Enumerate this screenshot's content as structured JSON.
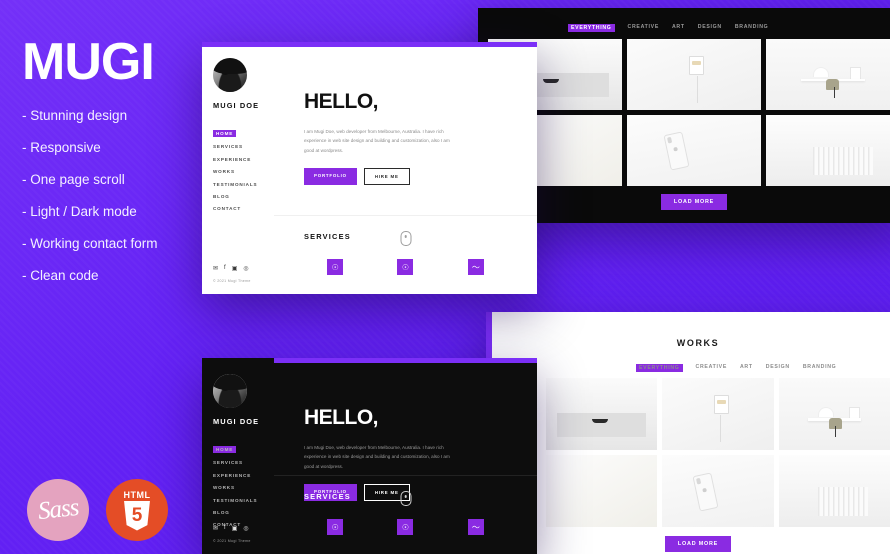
{
  "promo": {
    "title": "MUGI",
    "features": [
      "- Stunning design",
      "- Responsive",
      "- One page scroll",
      "- Light / Dark mode",
      "- Working contact form",
      "- Clean code"
    ]
  },
  "badges": [
    {
      "name": "Sass",
      "label": "Sass",
      "color": "#e4a3bf"
    },
    {
      "name": "HTML5",
      "top": "HTML",
      "num": "5",
      "color": "#e44d26"
    }
  ],
  "colors": {
    "background_purple": "#6622f5",
    "accent_purple": "#8a2be2",
    "topbar_purple": "#7b2ff7",
    "dark_panel": "#0d0d0d",
    "light_panel": "#ffffff"
  },
  "sidebar": {
    "name": "MUGI DOE",
    "nav": [
      {
        "label": "HOME",
        "active": true
      },
      {
        "label": "SERVICES",
        "active": false
      },
      {
        "label": "EXPERIENCE",
        "active": false
      },
      {
        "label": "WORKS",
        "active": false
      },
      {
        "label": "TESTIMONIALS",
        "active": false
      },
      {
        "label": "BLOG",
        "active": false
      },
      {
        "label": "CONTACT",
        "active": false
      }
    ],
    "socials": [
      "twitter-icon",
      "facebook-icon",
      "instagram-icon",
      "dribbble-icon"
    ],
    "copyright": "© 2021 Mugi Theme"
  },
  "hero": {
    "heading": "HELLO,",
    "body": "I am Mugi Doe, web developer from Melbourne, Australia. I have rich experience in web site design and building and customization, also I am good at wordpress.",
    "primary_button": "PORTFOLIO",
    "ghost_button": "HIRE ME",
    "scroll_icon": "mouse-scroll-icon"
  },
  "services": {
    "heading": "SERVICES",
    "items": [
      {
        "icon": "lightbulb-icon",
        "glyph": "☉"
      },
      {
        "icon": "lightbulb-icon",
        "glyph": "☉"
      },
      {
        "icon": "chart-line-icon",
        "glyph": "〜"
      }
    ]
  },
  "portfolio": {
    "heading": "WORKS",
    "filters": [
      {
        "label": "EVERYTHING",
        "active": true
      },
      {
        "label": "CREATIVE",
        "active": false
      },
      {
        "label": "ART",
        "active": false
      },
      {
        "label": "DESIGN",
        "active": false
      },
      {
        "label": "BRANDING",
        "active": false
      }
    ],
    "load_more": "LOAD MORE",
    "thumbnails_dark": [
      {
        "name": "thumb-drawer",
        "art": "art-drawer"
      },
      {
        "name": "thumb-charger",
        "art": "art-charger"
      },
      {
        "name": "thumb-desk",
        "art": "art-desk"
      },
      {
        "name": "thumb-plain",
        "art": "art-plain"
      },
      {
        "name": "thumb-phone",
        "art": "art-phone"
      },
      {
        "name": "thumb-radiator",
        "art": "art-rad"
      }
    ],
    "thumbnails_light": [
      {
        "name": "thumb-drawer",
        "art": "art-drawer"
      },
      {
        "name": "thumb-charger",
        "art": "art-charger"
      },
      {
        "name": "thumb-desk",
        "art": "art-desk"
      },
      {
        "name": "thumb-plain",
        "art": "art-plain"
      },
      {
        "name": "thumb-phone",
        "art": "art-phone"
      },
      {
        "name": "thumb-radiator",
        "art": "art-rad"
      }
    ]
  }
}
